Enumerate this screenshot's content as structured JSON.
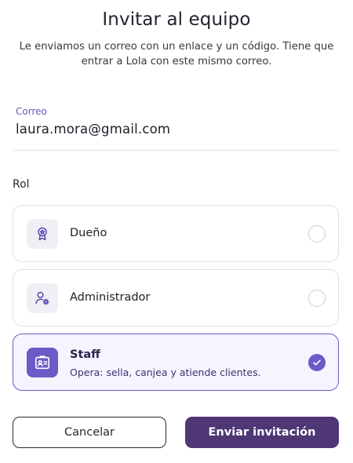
{
  "dialog": {
    "title": "Invitar al equipo",
    "subtitle": "Le enviamos un correo con un enlace y un código. Tiene que entrar a Lola con este mismo correo."
  },
  "email_field": {
    "label": "Correo",
    "value": "laura.mora@gmail.com"
  },
  "roles": {
    "section_label": "Rol",
    "items": [
      {
        "name": "Dueño",
        "icon": "award-badge-icon",
        "selected": false
      },
      {
        "name": "Administrador",
        "icon": "user-settings-icon",
        "selected": false
      },
      {
        "name": "Staff",
        "description": "Opera: sella, canjea y atiende clientes.",
        "icon": "id-card-icon",
        "selected": true
      }
    ]
  },
  "actions": {
    "cancel_label": "Cancelar",
    "submit_label": "Enviar invitación"
  },
  "colors": {
    "accent": "#6b5ac8",
    "primary_button": "#4f3775",
    "selected_card_bg": "#f6f4ff"
  }
}
